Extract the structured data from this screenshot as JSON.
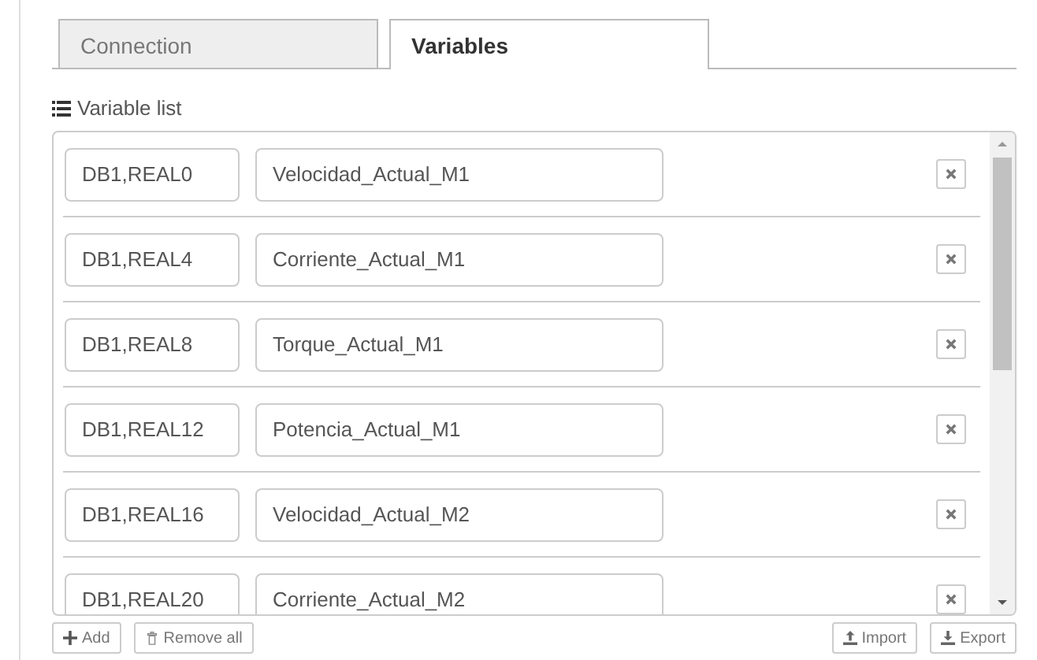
{
  "tabs": [
    {
      "label": "Connection",
      "selected": false
    },
    {
      "label": "Variables",
      "selected": true
    }
  ],
  "section_title": "Variable list",
  "variables": [
    {
      "address": "DB1,REAL0",
      "name": "Velocidad_Actual_M1"
    },
    {
      "address": "DB1,REAL4",
      "name": "Corriente_Actual_M1"
    },
    {
      "address": "DB1,REAL8",
      "name": "Torque_Actual_M1"
    },
    {
      "address": "DB1,REAL12",
      "name": "Potencia_Actual_M1"
    },
    {
      "address": "DB1,REAL16",
      "name": "Velocidad_Actual_M2"
    },
    {
      "address": "DB1,REAL20",
      "name": "Corriente_Actual_M2"
    }
  ],
  "left_buttons": [
    {
      "label": "Add",
      "kind": "add"
    },
    {
      "label": "Remove all",
      "kind": "trash"
    }
  ],
  "right_buttons": [
    {
      "label": "Import",
      "kind": "upload"
    },
    {
      "label": "Export",
      "kind": "download"
    }
  ]
}
